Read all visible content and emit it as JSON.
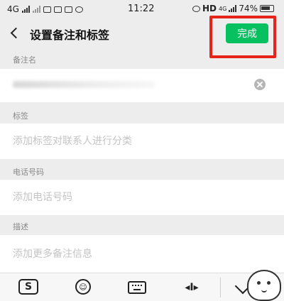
{
  "status_bar": {
    "network": "4G",
    "time": "11:22",
    "hd_label": "HD",
    "network_right": "4G",
    "battery": "74%"
  },
  "header": {
    "title": "设置备注和标签",
    "done_label": "完成",
    "accent_color": "#07c160",
    "highlight_color": "#e8241a"
  },
  "remark": {
    "label": "备注名",
    "value": ""
  },
  "tags": {
    "label": "标签",
    "placeholder": "添加标签对联系人进行分类"
  },
  "phone": {
    "label": "电话号码",
    "placeholder": "添加电话号码"
  },
  "description": {
    "label": "描述",
    "placeholder": "添加更多备注信息"
  },
  "keyboard_toolbar": {
    "logo_glyph": "S",
    "emoji_glyph": "☺",
    "cursor_glyph": "◂I▸"
  }
}
